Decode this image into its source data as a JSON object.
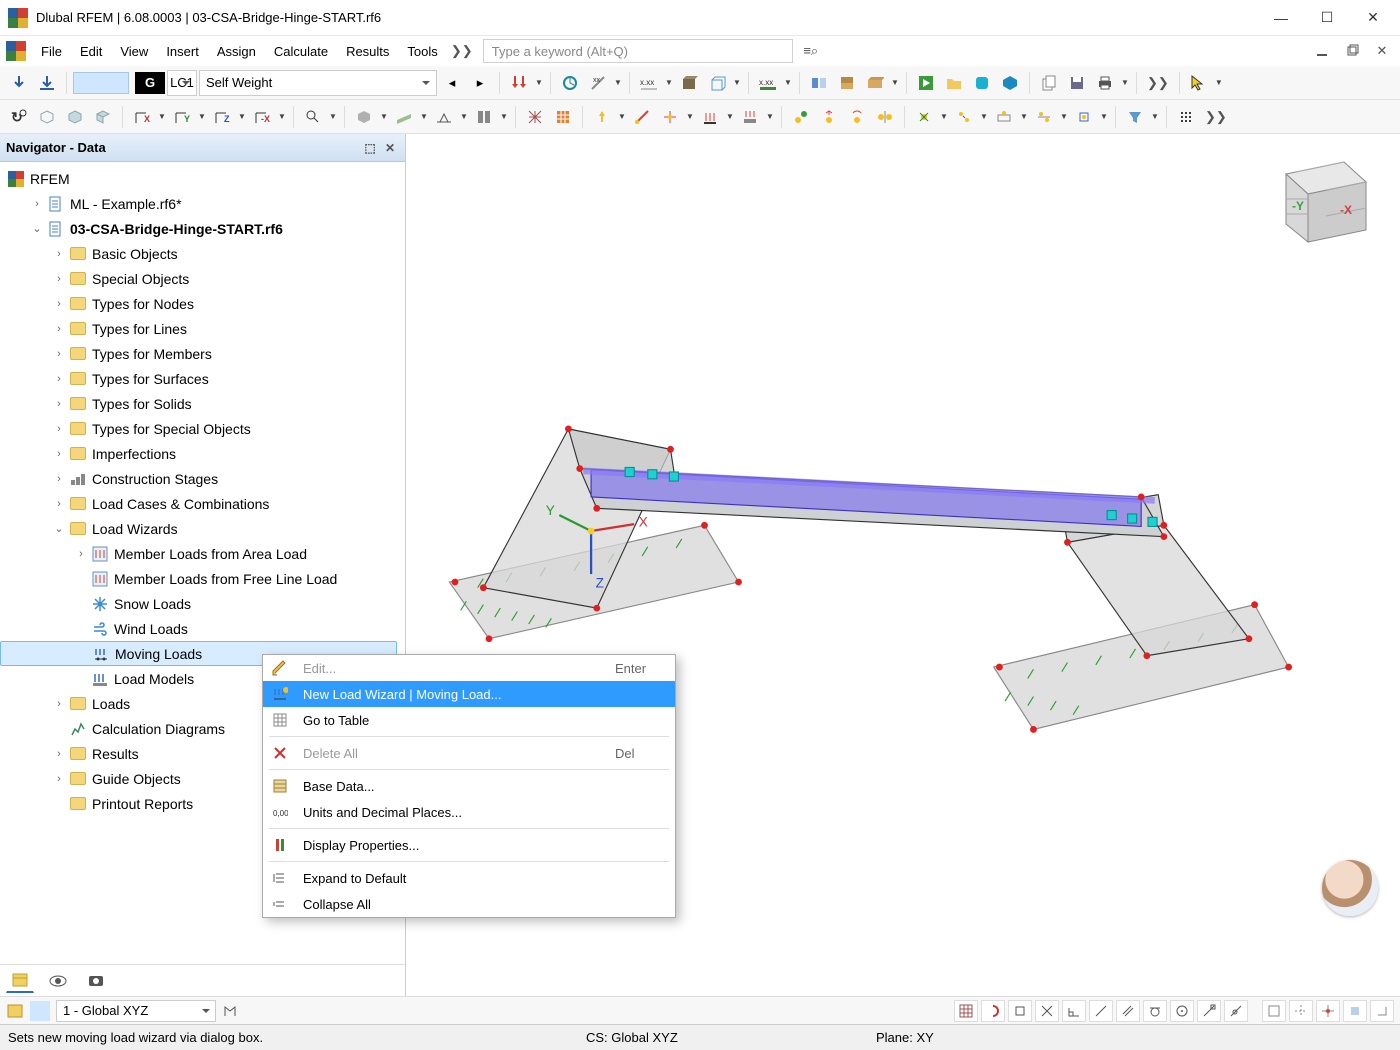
{
  "title": "Dlubal RFEM | 6.08.0003 | 03-CSA-Bridge-Hinge-START.rf6",
  "menu": [
    "File",
    "Edit",
    "View",
    "Insert",
    "Assign",
    "Calculate",
    "Results",
    "Tools"
  ],
  "menu_overflow": "❯❯",
  "search_placeholder": "Type a keyword (Alt+Q)",
  "lc_badge": "G",
  "lc_code": "LC1",
  "lc_name": "Self Weight",
  "navigator_title": "Navigator - Data",
  "tree_root": "RFEM",
  "tree": [
    {
      "lvl": 1,
      "exp": ">",
      "icon": "file",
      "label": "ML - Example.rf6*",
      "bold": false
    },
    {
      "lvl": 1,
      "exp": "v",
      "icon": "file",
      "label": "03-CSA-Bridge-Hinge-START.rf6",
      "bold": true
    },
    {
      "lvl": 2,
      "exp": ">",
      "icon": "fold",
      "label": "Basic Objects"
    },
    {
      "lvl": 2,
      "exp": ">",
      "icon": "fold",
      "label": "Special Objects"
    },
    {
      "lvl": 2,
      "exp": ">",
      "icon": "fold",
      "label": "Types for Nodes"
    },
    {
      "lvl": 2,
      "exp": ">",
      "icon": "fold",
      "label": "Types for Lines"
    },
    {
      "lvl": 2,
      "exp": ">",
      "icon": "fold",
      "label": "Types for Members"
    },
    {
      "lvl": 2,
      "exp": ">",
      "icon": "fold",
      "label": "Types for Surfaces"
    },
    {
      "lvl": 2,
      "exp": ">",
      "icon": "fold",
      "label": "Types for Solids"
    },
    {
      "lvl": 2,
      "exp": ">",
      "icon": "fold",
      "label": "Types for Special Objects"
    },
    {
      "lvl": 2,
      "exp": ">",
      "icon": "fold",
      "label": "Imperfections"
    },
    {
      "lvl": 2,
      "exp": ">",
      "icon": "stage",
      "label": "Construction Stages"
    },
    {
      "lvl": 2,
      "exp": ">",
      "icon": "fold",
      "label": "Load Cases & Combinations"
    },
    {
      "lvl": 2,
      "exp": "v",
      "icon": "fold",
      "label": "Load Wizards"
    },
    {
      "lvl": 3,
      "exp": ">",
      "icon": "w",
      "label": "Member Loads from Area Load"
    },
    {
      "lvl": 3,
      "exp": "",
      "icon": "w",
      "label": "Member Loads from Free Line Load"
    },
    {
      "lvl": 3,
      "exp": "",
      "icon": "snow",
      "label": "Snow Loads"
    },
    {
      "lvl": 3,
      "exp": "",
      "icon": "wind",
      "label": "Wind Loads"
    },
    {
      "lvl": 3,
      "exp": "",
      "icon": "mv",
      "label": "Moving Loads",
      "sel": true,
      "ptr": true
    },
    {
      "lvl": 3,
      "exp": "",
      "icon": "lm",
      "label": "Load Models"
    },
    {
      "lvl": 2,
      "exp": ">",
      "icon": "fold",
      "label": "Loads"
    },
    {
      "lvl": 2,
      "exp": "",
      "icon": "calc",
      "label": "Calculation Diagrams"
    },
    {
      "lvl": 2,
      "exp": ">",
      "icon": "fold",
      "label": "Results"
    },
    {
      "lvl": 2,
      "exp": ">",
      "icon": "fold",
      "label": "Guide Objects"
    },
    {
      "lvl": 2,
      "exp": "",
      "icon": "fold",
      "label": "Printout Reports"
    }
  ],
  "context_menu": [
    {
      "label": "Edit...",
      "short": "Enter",
      "dis": true
    },
    {
      "label": "New Load Wizard | Moving Load...",
      "hi": true
    },
    {
      "label": "Go to Table"
    },
    {
      "sep": true
    },
    {
      "label": "Delete All",
      "short": "Del",
      "dis": true
    },
    {
      "sep": true
    },
    {
      "label": "Base Data..."
    },
    {
      "label": "Units and Decimal Places..."
    },
    {
      "sep": true
    },
    {
      "label": "Display Properties..."
    },
    {
      "sep": true
    },
    {
      "label": "Expand to Default"
    },
    {
      "label": "Collapse All"
    }
  ],
  "status_combo": "1 - Global XYZ",
  "status_text": "Sets new moving load wizard via dialog box.",
  "status_cs": "CS: Global XYZ",
  "status_plane": "Plane: XY",
  "axis": {
    "x": "X",
    "y": "Y",
    "z": "Z"
  },
  "cube_y": "-Y",
  "cube_x": "-X"
}
